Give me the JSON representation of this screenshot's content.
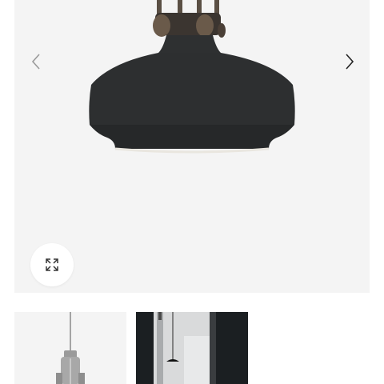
{
  "gallery": {
    "prev_icon": "chevron-left-icon",
    "next_icon": "chevron-right-icon",
    "expand_icon": "expand-arrows-icon",
    "background_color": "#f4f4f4",
    "lamp_color": "#2a2c2d"
  },
  "thumbnails": [
    {
      "name": "thumbnail-lamp-product",
      "selected": false
    },
    {
      "name": "thumbnail-lamp-interior",
      "selected": false
    }
  ]
}
